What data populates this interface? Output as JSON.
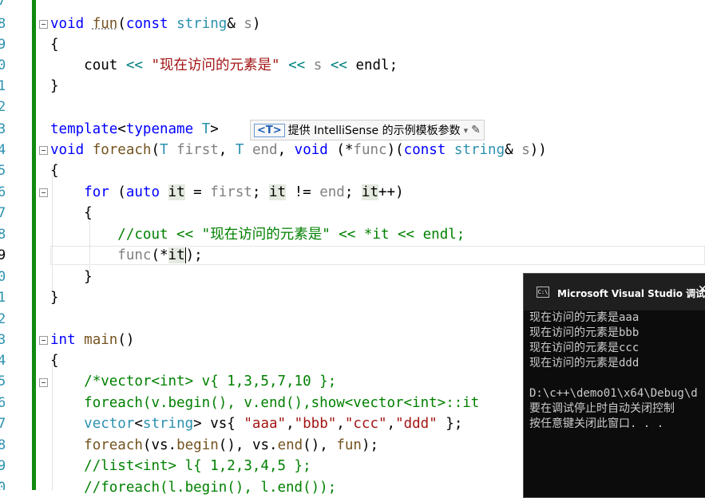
{
  "gutter": {
    "line_numbers": [
      "7",
      "8",
      "9",
      "0",
      "1",
      "2",
      "3",
      "4",
      "5",
      "6",
      "7",
      "8",
      "9",
      "0",
      "1",
      "2",
      "3",
      "4",
      "5",
      "6",
      "7",
      "8",
      "9",
      "0"
    ]
  },
  "intellisense": {
    "tag": "<T>",
    "label": "提供 IntelliSense 的示例模板参数",
    "dropdown": "▾",
    "edit": "✎"
  },
  "code": {
    "l1_void": "void",
    "l1_fun": "fun",
    "l1_p1": "(",
    "l1_const": "const",
    "l1_string": "string",
    "l1_amp": "& ",
    "l1_s": "s",
    "l1_p2": ")",
    "l2": "{",
    "l3_cout": "cout",
    "l3_op1": "<<",
    "l3_str": "\"现在访问的元素是\"",
    "l3_op2": "<<",
    "l3_s": "s",
    "l3_op3": "<<",
    "l3_endl": "endl",
    "l3_semi": ";",
    "l4": "}",
    "l6_template": "template",
    "l6_lt": "<",
    "l6_typename": "typename",
    "l6_T": "T",
    "l6_gt": ">",
    "l7_void": "void",
    "l7_foreach": "foreach",
    "l7_p1": "(",
    "l7_T1": "T",
    "l7_first": "first",
    "l7_c1": ", ",
    "l7_T2": "T",
    "l7_end": "end",
    "l7_c2": ", ",
    "l7_void2": "void",
    "l7_sp": " (*",
    "l7_func": "func",
    ")": ")",
    "l7_p3": ")(",
    "l7_const": "const",
    "l7_string": "string",
    "l7_amp": "& ",
    "l7_s": "s",
    "l7_p4": "))",
    "l8": "{",
    "l9_for": "for",
    "l9_p1": " (",
    "l9_auto": "auto",
    "l9_it1": "it",
    "l9_eq": " = ",
    "l9_first": "first",
    "l9_semi1": "; ",
    "l9_it2": "it",
    "l9_neq": " != ",
    "l9_end": "end",
    "l9_semi2": "; ",
    "l9_it3": "it",
    "l9_inc": "++)",
    "l10": "{",
    "l11": "//cout << \"现在访问的元素是\" << *it << endl;",
    "l12_func": "func",
    "l12_p1": "(*",
    "l12_it": "it",
    "l12_p2": ");",
    "l13": "}",
    "l14": "}",
    "l16_int": "int",
    "l16_main": "main",
    "l16_p": "()",
    "l17": "{",
    "l18": "/*vector<int> v{ 1,3,5,7,10 };",
    "l19": "foreach(v.begin(), v.end(),show<vector<int>::it",
    "l20_vector": "vector",
    "l20_lt": "<",
    "l20_string": "string",
    "l20_gt": ">",
    "l20_vs": " vs{ ",
    "l20_a": "\"aaa\"",
    "l20_c1": ",",
    "l20_b": "\"bbb\"",
    "l20_c2": ",",
    "l20_c": "\"ccc\"",
    "l20_c3": ",",
    "l20_d": "\"ddd\"",
    "l20_end": " };",
    "l21_foreach": "foreach",
    "l21_p1": "(",
    "l21_vs1": "vs",
    ".": ".",
    "l21_begin": "begin",
    "l21_p2": "(), ",
    "l21_vs2": "vs",
    "l21_end": "end",
    "l21_p3": "(), ",
    "l21_fun": "fun",
    "l21_p4": ");",
    "l22": "//list<int> l{ 1,2,3,4,5 };",
    "l23": "//foreach(l.begin(), l.end());"
  },
  "console": {
    "title": "Microsoft Visual Studio 调试控",
    "icon": "C:\\",
    "lines": [
      "现在访问的元素是aaa",
      "现在访问的元素是bbb",
      "现在访问的元素是ccc",
      "现在访问的元素是ddd",
      "",
      "D:\\c++\\demo01\\x64\\Debug\\d",
      "要在调试停止时自动关闭控制",
      "按任意键关闭此窗口. . ."
    ]
  }
}
